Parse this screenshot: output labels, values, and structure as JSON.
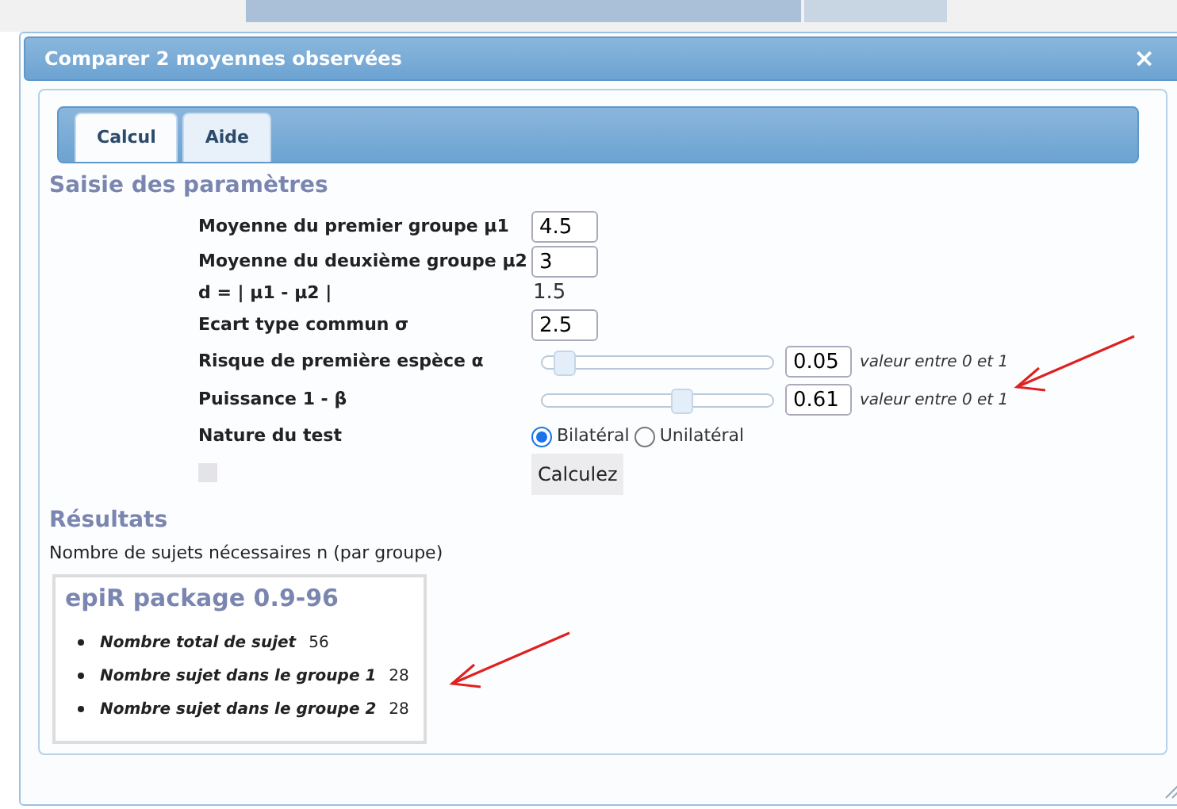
{
  "dialog": {
    "title": "Comparer 2 moyennes observées",
    "close": "×"
  },
  "tabs": [
    {
      "label": "Calcul",
      "selected": true
    },
    {
      "label": "Aide",
      "selected": false
    }
  ],
  "parameters": {
    "heading": "Saisie des paramètres",
    "rows": [
      {
        "kind": "input",
        "label": "Moyenne du premier groupe µ1",
        "value": "4.5"
      },
      {
        "kind": "input",
        "label": "Moyenne du deuxième groupe µ2",
        "value": "3"
      },
      {
        "kind": "text",
        "label": "d = | µ1 - µ2 |",
        "value": "1.5"
      },
      {
        "kind": "input",
        "label": "Ecart type commun σ",
        "value": "2.5"
      },
      {
        "kind": "slider",
        "label": "Risque de première espèce α",
        "level": 0.05,
        "value": "0.05",
        "hint": "valeur entre 0 et 1"
      },
      {
        "kind": "slider",
        "label": "Puissance 1 - β",
        "level": 0.61,
        "value": "0.61",
        "hint": "valeur entre 0 et 1"
      },
      {
        "kind": "radio",
        "label": "Nature du test",
        "options": [
          {
            "label": "Bilatéral",
            "selected": true
          },
          {
            "label": "Unilatéral",
            "selected": false
          }
        ]
      }
    ],
    "checkbox": {
      "checked": false
    },
    "button": "Calculez"
  },
  "results": {
    "heading": "Résultats",
    "caption": "Nombre de sujets nécessaires n (par groupe)",
    "box_title": "epiR package 0.9-96",
    "items": [
      {
        "label": "Nombre total de sujet",
        "value": "56"
      },
      {
        "label": "Nombre sujet dans le groupe 1",
        "value": "28"
      },
      {
        "label": "Nombre sujet dans le groupe 2",
        "value": "28"
      }
    ]
  }
}
